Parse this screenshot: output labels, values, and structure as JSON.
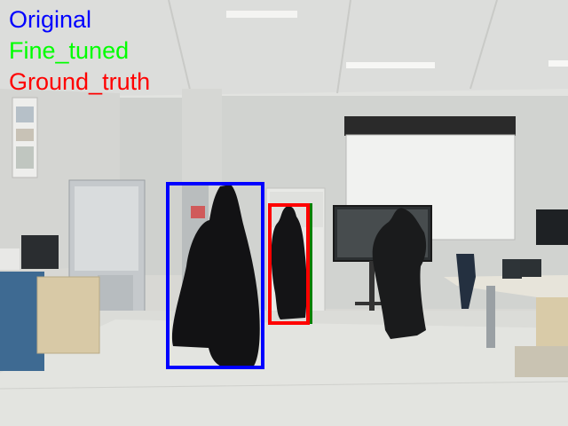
{
  "legend": [
    {
      "label": "Original",
      "color": "#0000ff"
    },
    {
      "label": "Fine_tuned",
      "color": "#00ff00"
    },
    {
      "label": "Ground_truth",
      "color": "#ff0000"
    }
  ],
  "boxes": {
    "original": {
      "color": "#0000ff"
    },
    "fine_tuned": {
      "color": "#008000"
    },
    "ground_truth": {
      "color": "#ff0000"
    }
  }
}
